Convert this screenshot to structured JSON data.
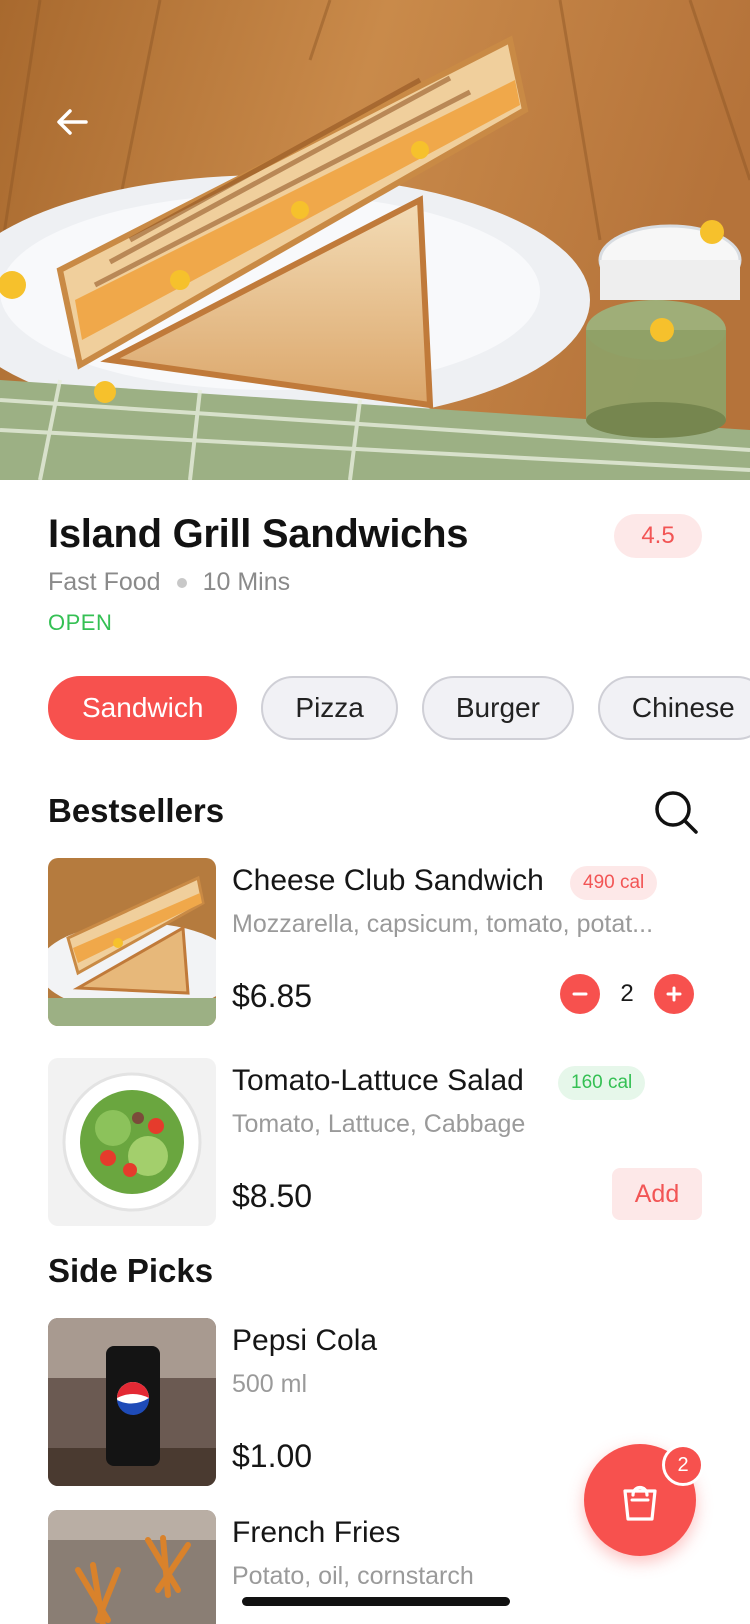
{
  "restaurant": {
    "name": "Island Grill Sandwichs",
    "rating": "4.5",
    "cuisine": "Fast Food",
    "delivery_time": "10 Mins",
    "status": "OPEN"
  },
  "categories": [
    {
      "label": "Sandwich",
      "active": true
    },
    {
      "label": "Pizza",
      "active": false
    },
    {
      "label": "Burger",
      "active": false
    },
    {
      "label": "Chinese",
      "active": false
    }
  ],
  "sections": {
    "bestsellers": {
      "title": "Bestsellers",
      "items": [
        {
          "name": "Cheese Club Sandwich",
          "calories": "490 cal",
          "description": "Mozzarella, capsicum, tomato, potat...",
          "price": "$6.85",
          "quantity": "2"
        },
        {
          "name": "Tomato-Lattuce Salad",
          "calories": "160 cal",
          "description": "Tomato, Lattuce, Cabbage",
          "price": "$8.50",
          "action": "Add"
        }
      ]
    },
    "side_picks": {
      "title": "Side Picks",
      "items": [
        {
          "name": "Pepsi Cola",
          "description": "500 ml",
          "price": "$1.00"
        },
        {
          "name": "French Fries",
          "description": "Potato, oil, cornstarch"
        }
      ]
    }
  },
  "cart": {
    "count": "2"
  },
  "icons": {
    "back": "arrow-left-icon",
    "search": "search-icon",
    "minus": "minus-icon",
    "plus": "plus-icon",
    "cart": "shopping-bag-icon"
  },
  "colors": {
    "accent": "#f7514e",
    "accent_light": "#fde8e8",
    "open_green": "#35c054"
  }
}
